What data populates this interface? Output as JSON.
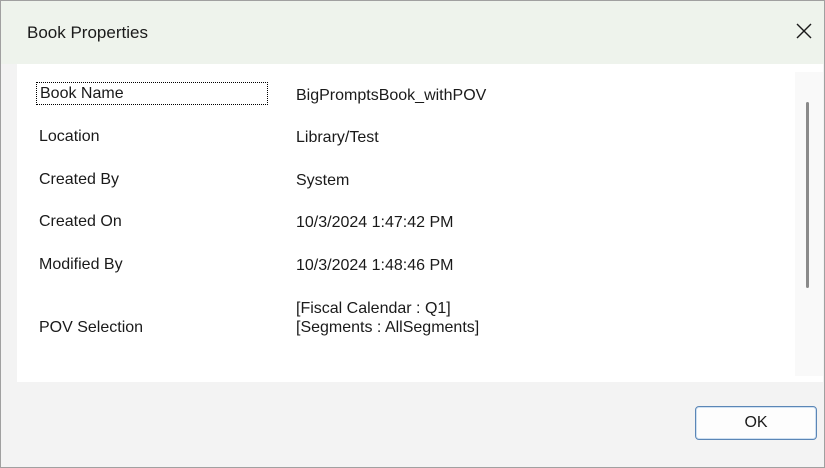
{
  "window": {
    "title": "Book Properties",
    "close_icon": "close-icon"
  },
  "properties": [
    {
      "label": "Book Name",
      "value": "BigPromptsBook_withPOV"
    },
    {
      "label": "Location",
      "value": "Library/Test"
    },
    {
      "label": "Created By",
      "value": "System"
    },
    {
      "label": "Created On",
      "value": "10/3/2024 1:47:42 PM"
    },
    {
      "label": "Modified By",
      "value": "10/3/2024 1:48:46 PM"
    },
    {
      "label": "POV Selection",
      "value_lines": [
        "[Fiscal Calendar : Q1]",
        "[Segments : AllSegments]"
      ]
    }
  ],
  "footer": {
    "ok_label": "OK"
  }
}
